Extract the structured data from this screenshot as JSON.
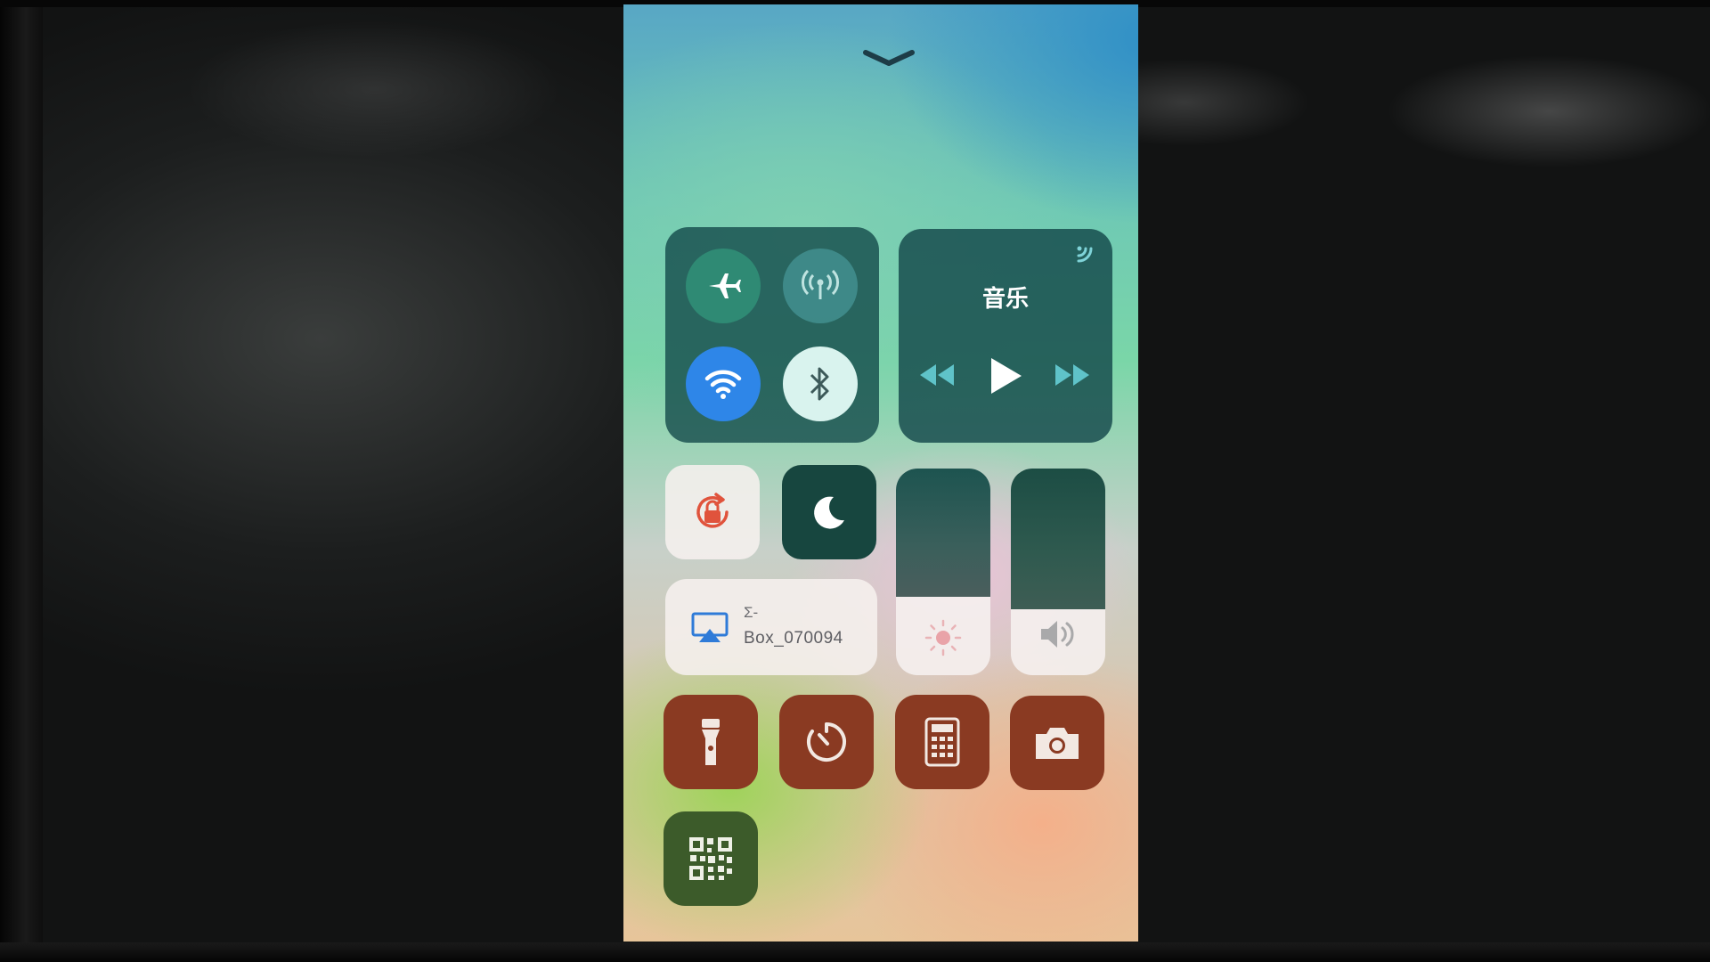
{
  "control_center": {
    "music": {
      "title": "音乐"
    },
    "screen_mirroring": {
      "line1": "Σ-",
      "line2": "Box_070094"
    },
    "colors": {
      "wifi_active": "#2e86e8",
      "airplane_active": "#2f8a74",
      "app_tile": "#8a3a22",
      "scanner_tile": "#3c5b2a"
    },
    "brightness_level": 0.38,
    "volume_level": 0.32,
    "icons": {
      "collapse": "chevron-down-icon",
      "airplane": "airplane-icon",
      "cellular": "cellular-data-icon",
      "wifi": "wifi-icon",
      "bluetooth": "bluetooth-icon",
      "airplay_audio": "airplay-audio-icon",
      "previous": "rewind-icon",
      "play": "play-icon",
      "next": "fast-forward-icon",
      "rotation_lock": "rotation-lock-icon",
      "do_not_disturb": "moon-icon",
      "screen_mirroring": "screen-mirroring-icon",
      "brightness": "sun-icon",
      "volume": "speaker-icon",
      "flashlight": "flashlight-icon",
      "timer": "timer-icon",
      "calculator": "calculator-icon",
      "camera": "camera-icon",
      "qr_scanner": "qr-code-icon"
    }
  }
}
